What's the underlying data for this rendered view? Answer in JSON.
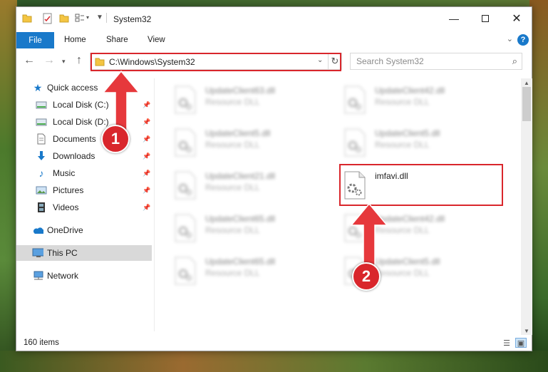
{
  "window": {
    "title": "System32"
  },
  "ribbon": {
    "file": "File",
    "home": "Home",
    "share": "Share",
    "view": "View",
    "help": "?"
  },
  "address": {
    "path": "C:\\Windows\\System32"
  },
  "search": {
    "placeholder": "Search System32"
  },
  "nav": {
    "quick_access": "Quick access",
    "local_c": "Local Disk (C:)",
    "local_d": "Local Disk (D:)",
    "documents": "Documents",
    "downloads": "Downloads",
    "music": "Music",
    "pictures": "Pictures",
    "videos": "Videos",
    "onedrive": "OneDrive",
    "this_pc": "This PC",
    "network": "Network"
  },
  "files": {
    "f1": {
      "name": "UpdateClient63.dll",
      "type": "Resource DLL"
    },
    "f2": {
      "name": "UpdateClient42.dll",
      "type": "Resource DLL"
    },
    "f3": {
      "name": "UpdateClient5.dll",
      "type": "Resource DLL"
    },
    "f4": {
      "name": "UpdateClient5.dll",
      "type": "Resource DLL"
    },
    "f5": {
      "name": "UpdateClient21.dll",
      "type": "Resource DLL"
    },
    "f6": {
      "name": "imfavi.dll",
      "type": ""
    },
    "f7": {
      "name": "UpdateClient65.dll",
      "type": "Resource DLL"
    },
    "f8": {
      "name": "UpdateClient42.dll",
      "type": "Resource DLL"
    },
    "f9": {
      "name": "UpdateClient65.dll",
      "type": "Resource DLL"
    },
    "f10": {
      "name": "UpdateClient5.dll",
      "type": "Resource DLL"
    }
  },
  "status": {
    "items": "160 items"
  },
  "annotations": {
    "step1": "1",
    "step2": "2"
  },
  "colors": {
    "accent": "#1979ca",
    "highlight": "#d9262c",
    "folder": "#f4c542"
  }
}
